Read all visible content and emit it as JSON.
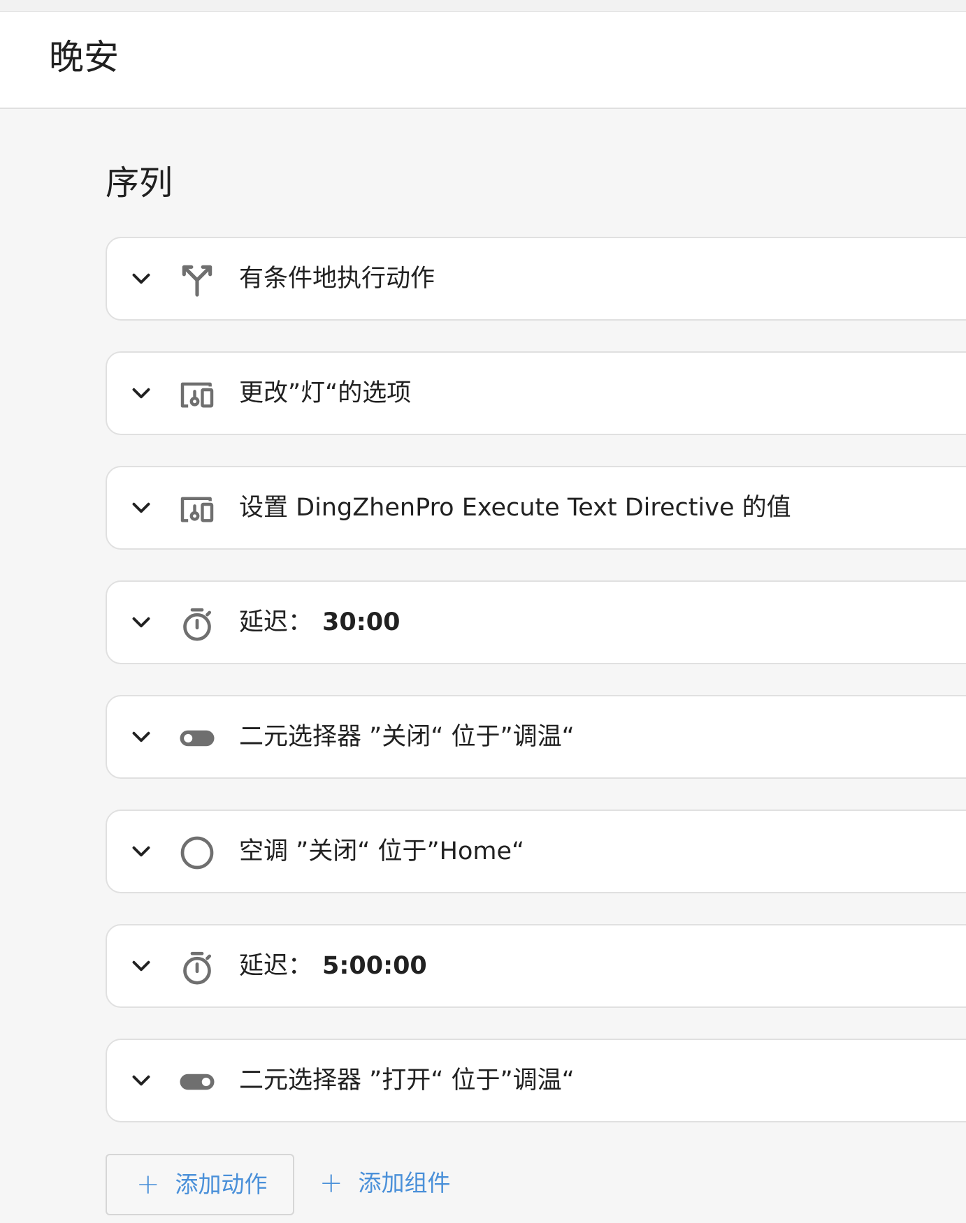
{
  "header": {
    "title": "晚安"
  },
  "section": {
    "title": "序列"
  },
  "actions": [
    {
      "icon": "fork-icon",
      "label": "有条件地执行动作",
      "value": ""
    },
    {
      "icon": "devices-icon",
      "label": "更改”灯“的选项",
      "value": ""
    },
    {
      "icon": "devices-icon",
      "label": "设置 DingZhenPro Execute Text Directive 的值",
      "value": ""
    },
    {
      "icon": "timer-icon",
      "label": "延迟：",
      "value": "30:00"
    },
    {
      "icon": "toggle-off-icon",
      "label": "二元选择器 ”关闭“ 位于”调温“",
      "value": ""
    },
    {
      "icon": "circle-icon",
      "label": "空调 ”关闭“ 位于”Home“",
      "value": ""
    },
    {
      "icon": "timer-icon",
      "label": "延迟：",
      "value": "5:00:00"
    },
    {
      "icon": "toggle-on-icon",
      "label": "二元选择器 ”打开“ 位于”调温“",
      "value": ""
    }
  ],
  "footer": {
    "add_action_label": "添加动作",
    "add_block_label": "添加组件",
    "plus_glyph": "+"
  },
  "colors": {
    "accent": "#4a90d9",
    "icon": "#6f6f6f",
    "text": "#212121",
    "card_border": "#e0e0e0"
  }
}
